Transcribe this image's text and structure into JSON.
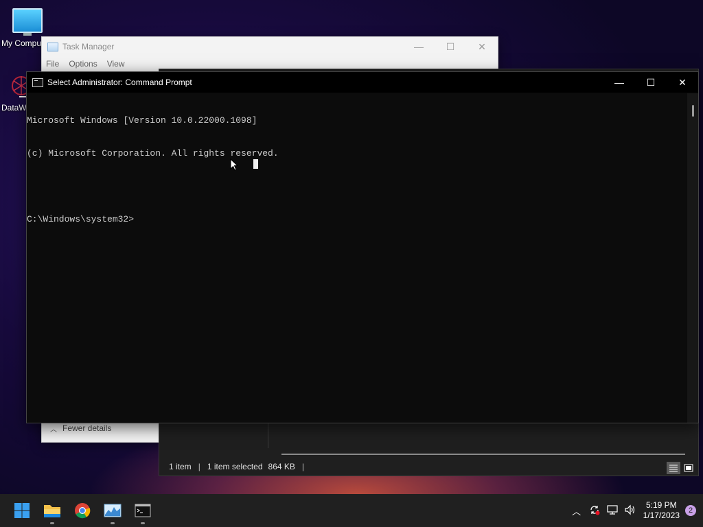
{
  "desktop": {
    "icons": [
      {
        "label": "My Compu"
      },
      {
        "label": "DataW"
      }
    ]
  },
  "taskmgr": {
    "title": "Task Manager",
    "menu": [
      "File",
      "Options",
      "View"
    ],
    "footer_label": "Fewer details",
    "controls": {
      "minimize": "—",
      "maximize": "☐",
      "close": "✕"
    }
  },
  "explorer": {
    "status_items": "1 item",
    "status_selected": "1 item selected",
    "status_size": "864 KB"
  },
  "cmd": {
    "title": "Select Administrator:  Command Prompt",
    "lines": [
      "Microsoft Windows [Version 10.0.22000.1098]",
      "(c) Microsoft Corporation. All rights reserved.",
      "",
      "C:\\Windows\\system32>"
    ],
    "controls": {
      "minimize": "—",
      "maximize": "☐",
      "close": "✕"
    }
  },
  "taskbar": {
    "apps": [
      {
        "name": "start-button"
      },
      {
        "name": "file-explorer"
      },
      {
        "name": "chrome"
      },
      {
        "name": "task-manager"
      },
      {
        "name": "command-prompt"
      }
    ],
    "tray": {
      "time": "5:19 PM",
      "date": "1/17/2023",
      "notification_count": "2"
    }
  },
  "colors": {
    "cmd_background": "#0c0c0c",
    "cmd_text": "#cccccc",
    "taskbar": "#202020"
  }
}
